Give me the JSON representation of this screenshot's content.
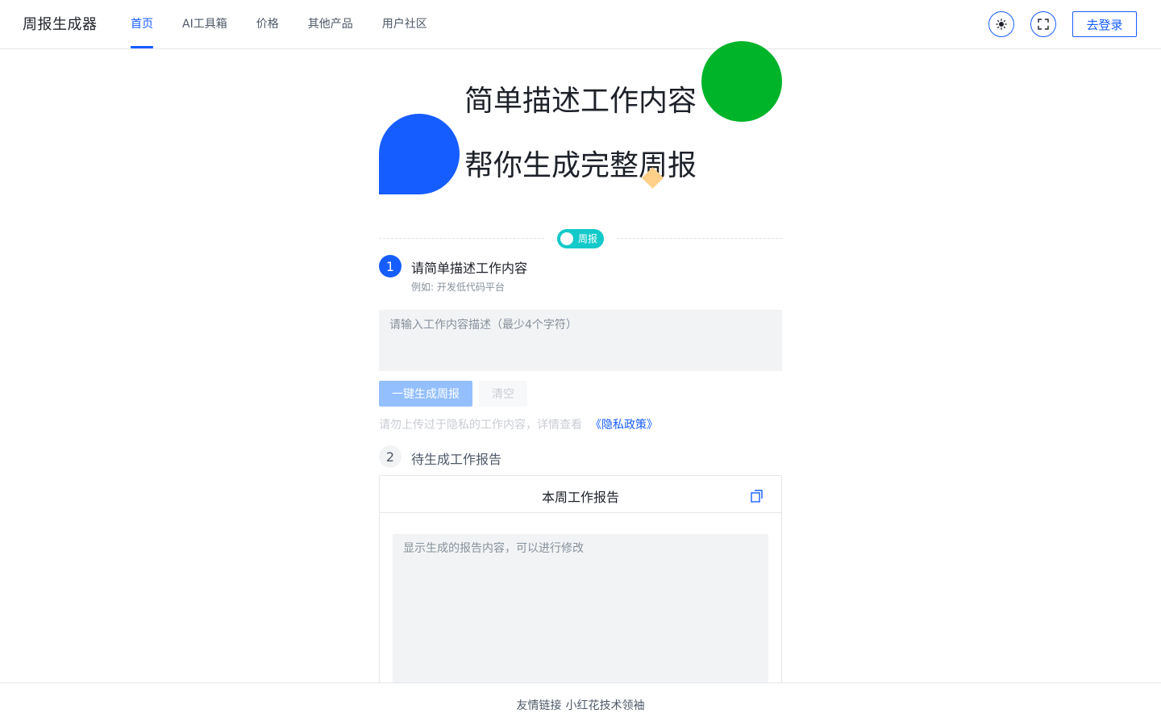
{
  "header": {
    "logo": "周报生成器",
    "nav": [
      {
        "label": "首页",
        "active": true
      },
      {
        "label": "AI工具箱"
      },
      {
        "label": "价格"
      },
      {
        "label": "其他产品"
      },
      {
        "label": "用户社区"
      }
    ],
    "theme_icon": "sun-icon",
    "fullscreen_icon": "fullscreen-icon",
    "login_label": "去登录"
  },
  "hero": {
    "line1": "简单描述工作内容",
    "line2": "帮你生成完整周报"
  },
  "mode_switch": {
    "label": "周报",
    "on": true
  },
  "step1": {
    "number": "1",
    "title": "请简单描述工作内容",
    "desc": "例如: 开发低代码平台",
    "placeholder": "请输入工作内容描述（最少4个字符）",
    "generate_label": "一键生成周报",
    "clear_label": "清空",
    "privacy_text": "请勿上传过于隐私的工作内容，详情查看",
    "privacy_link": "《隐私政策》"
  },
  "step2": {
    "number": "2",
    "title": "待生成工作报告",
    "card_title": "本周工作报告",
    "copy_icon": "copy-icon",
    "placeholder": "显示生成的报告内容，可以进行修改"
  },
  "footer": {
    "label": "友情链接",
    "link": "小红花技术领袖"
  },
  "colors": {
    "primary": "#165dff",
    "green": "#00b42a",
    "cyan": "#14c9c9",
    "orange": "#ffd08a",
    "disabled_primary": "#94bfff"
  }
}
